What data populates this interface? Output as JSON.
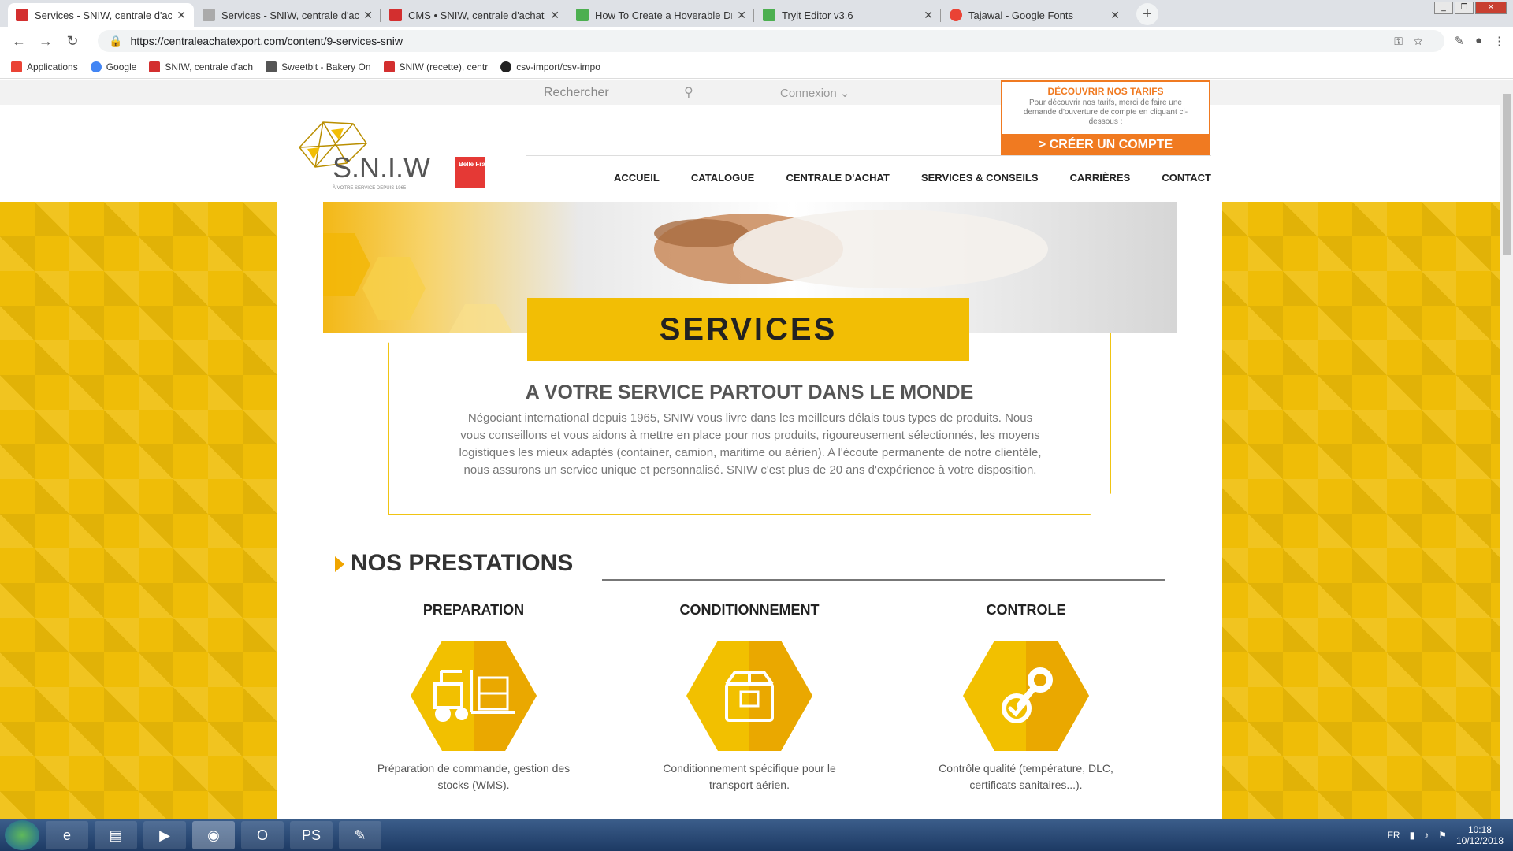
{
  "browser": {
    "tabs": [
      {
        "title": "Services - SNIW, centrale d'achat",
        "color": "#d32f2f"
      },
      {
        "title": "Services - SNIW, centrale d'achat",
        "color": "#888888"
      },
      {
        "title": "CMS • SNIW, centrale d'achat ex",
        "color": "#d32f2f"
      },
      {
        "title": "How To Create a Hoverable Drop",
        "color": "#4caf50"
      },
      {
        "title": "Tryit Editor v3.6",
        "color": "#4caf50"
      },
      {
        "title": "Tajawal - Google Fonts",
        "color": "#ea4335"
      }
    ],
    "url": "https://centraleachatexport.com/content/9-services-sniw",
    "bookmarks": [
      {
        "label": "Applications",
        "color": "#ea4335"
      },
      {
        "label": "Google",
        "color": "#4285f4"
      },
      {
        "label": "SNIW, centrale d'ach",
        "color": "#d32f2f"
      },
      {
        "label": "Sweetbit - Bakery On",
        "color": "#555555"
      },
      {
        "label": "SNIW (recette), centr",
        "color": "#d32f2f"
      },
      {
        "label": "csv-import/csv-impo",
        "color": "#222222"
      }
    ]
  },
  "site": {
    "search_label": "Rechercher",
    "login_label": "Connexion",
    "promo": {
      "title": "DÉCOUVRIR NOS TARIFS",
      "text": "Pour découvrir nos tarifs, merci de faire une demande d'ouverture de compte en cliquant ci-dessous :",
      "cta": "> CRÉER UN COMPTE"
    },
    "logo": {
      "name": "S.N.I.W",
      "tagline": "À VOTRE SERVICE DEPUIS 1965",
      "partner": "Belle France"
    },
    "nav": [
      "ACCUEIL",
      "CATALOGUE",
      "CENTRALE D'ACHAT",
      "SERVICES & CONSEILS",
      "CARRIÈRES",
      "CONTACT"
    ],
    "banner": "SERVICES",
    "intro_title": "A VOTRE SERVICE PARTOUT DANS LE MONDE",
    "intro_text": "Négociant international depuis 1965, SNIW vous livre dans les meilleurs délais tous types de produits. Nous vous conseillons et vous aidons à mettre en place pour nos produits, rigoureusement sélectionnés, les moyens logistiques les mieux adaptés (container, camion, maritime ou aérien). A l'écoute permanente de notre clientèle, nous assurons un service unique et personnalisé. SNIW c'est plus de 20 ans d'expérience à votre disposition.",
    "section_title": "NOS PRESTATIONS",
    "services": [
      {
        "title": "PREPARATION",
        "text": "Préparation de commande, gestion des stocks (WMS).",
        "icon": "forklift-icon"
      },
      {
        "title": "CONDITIONNEMENT",
        "text": "Conditionnement spécifique pour le transport aérien.",
        "icon": "package-icon"
      },
      {
        "title": "CONTROLE",
        "text": "Contrôle qualité (température, DLC, certificats sanitaires...).",
        "icon": "quality-check-icon"
      }
    ]
  },
  "taskbar": {
    "lang": "FR",
    "time": "10:18",
    "date": "10/12/2018"
  },
  "colors": {
    "brand_yellow": "#f2be05",
    "brand_orange": "#f07a21"
  }
}
